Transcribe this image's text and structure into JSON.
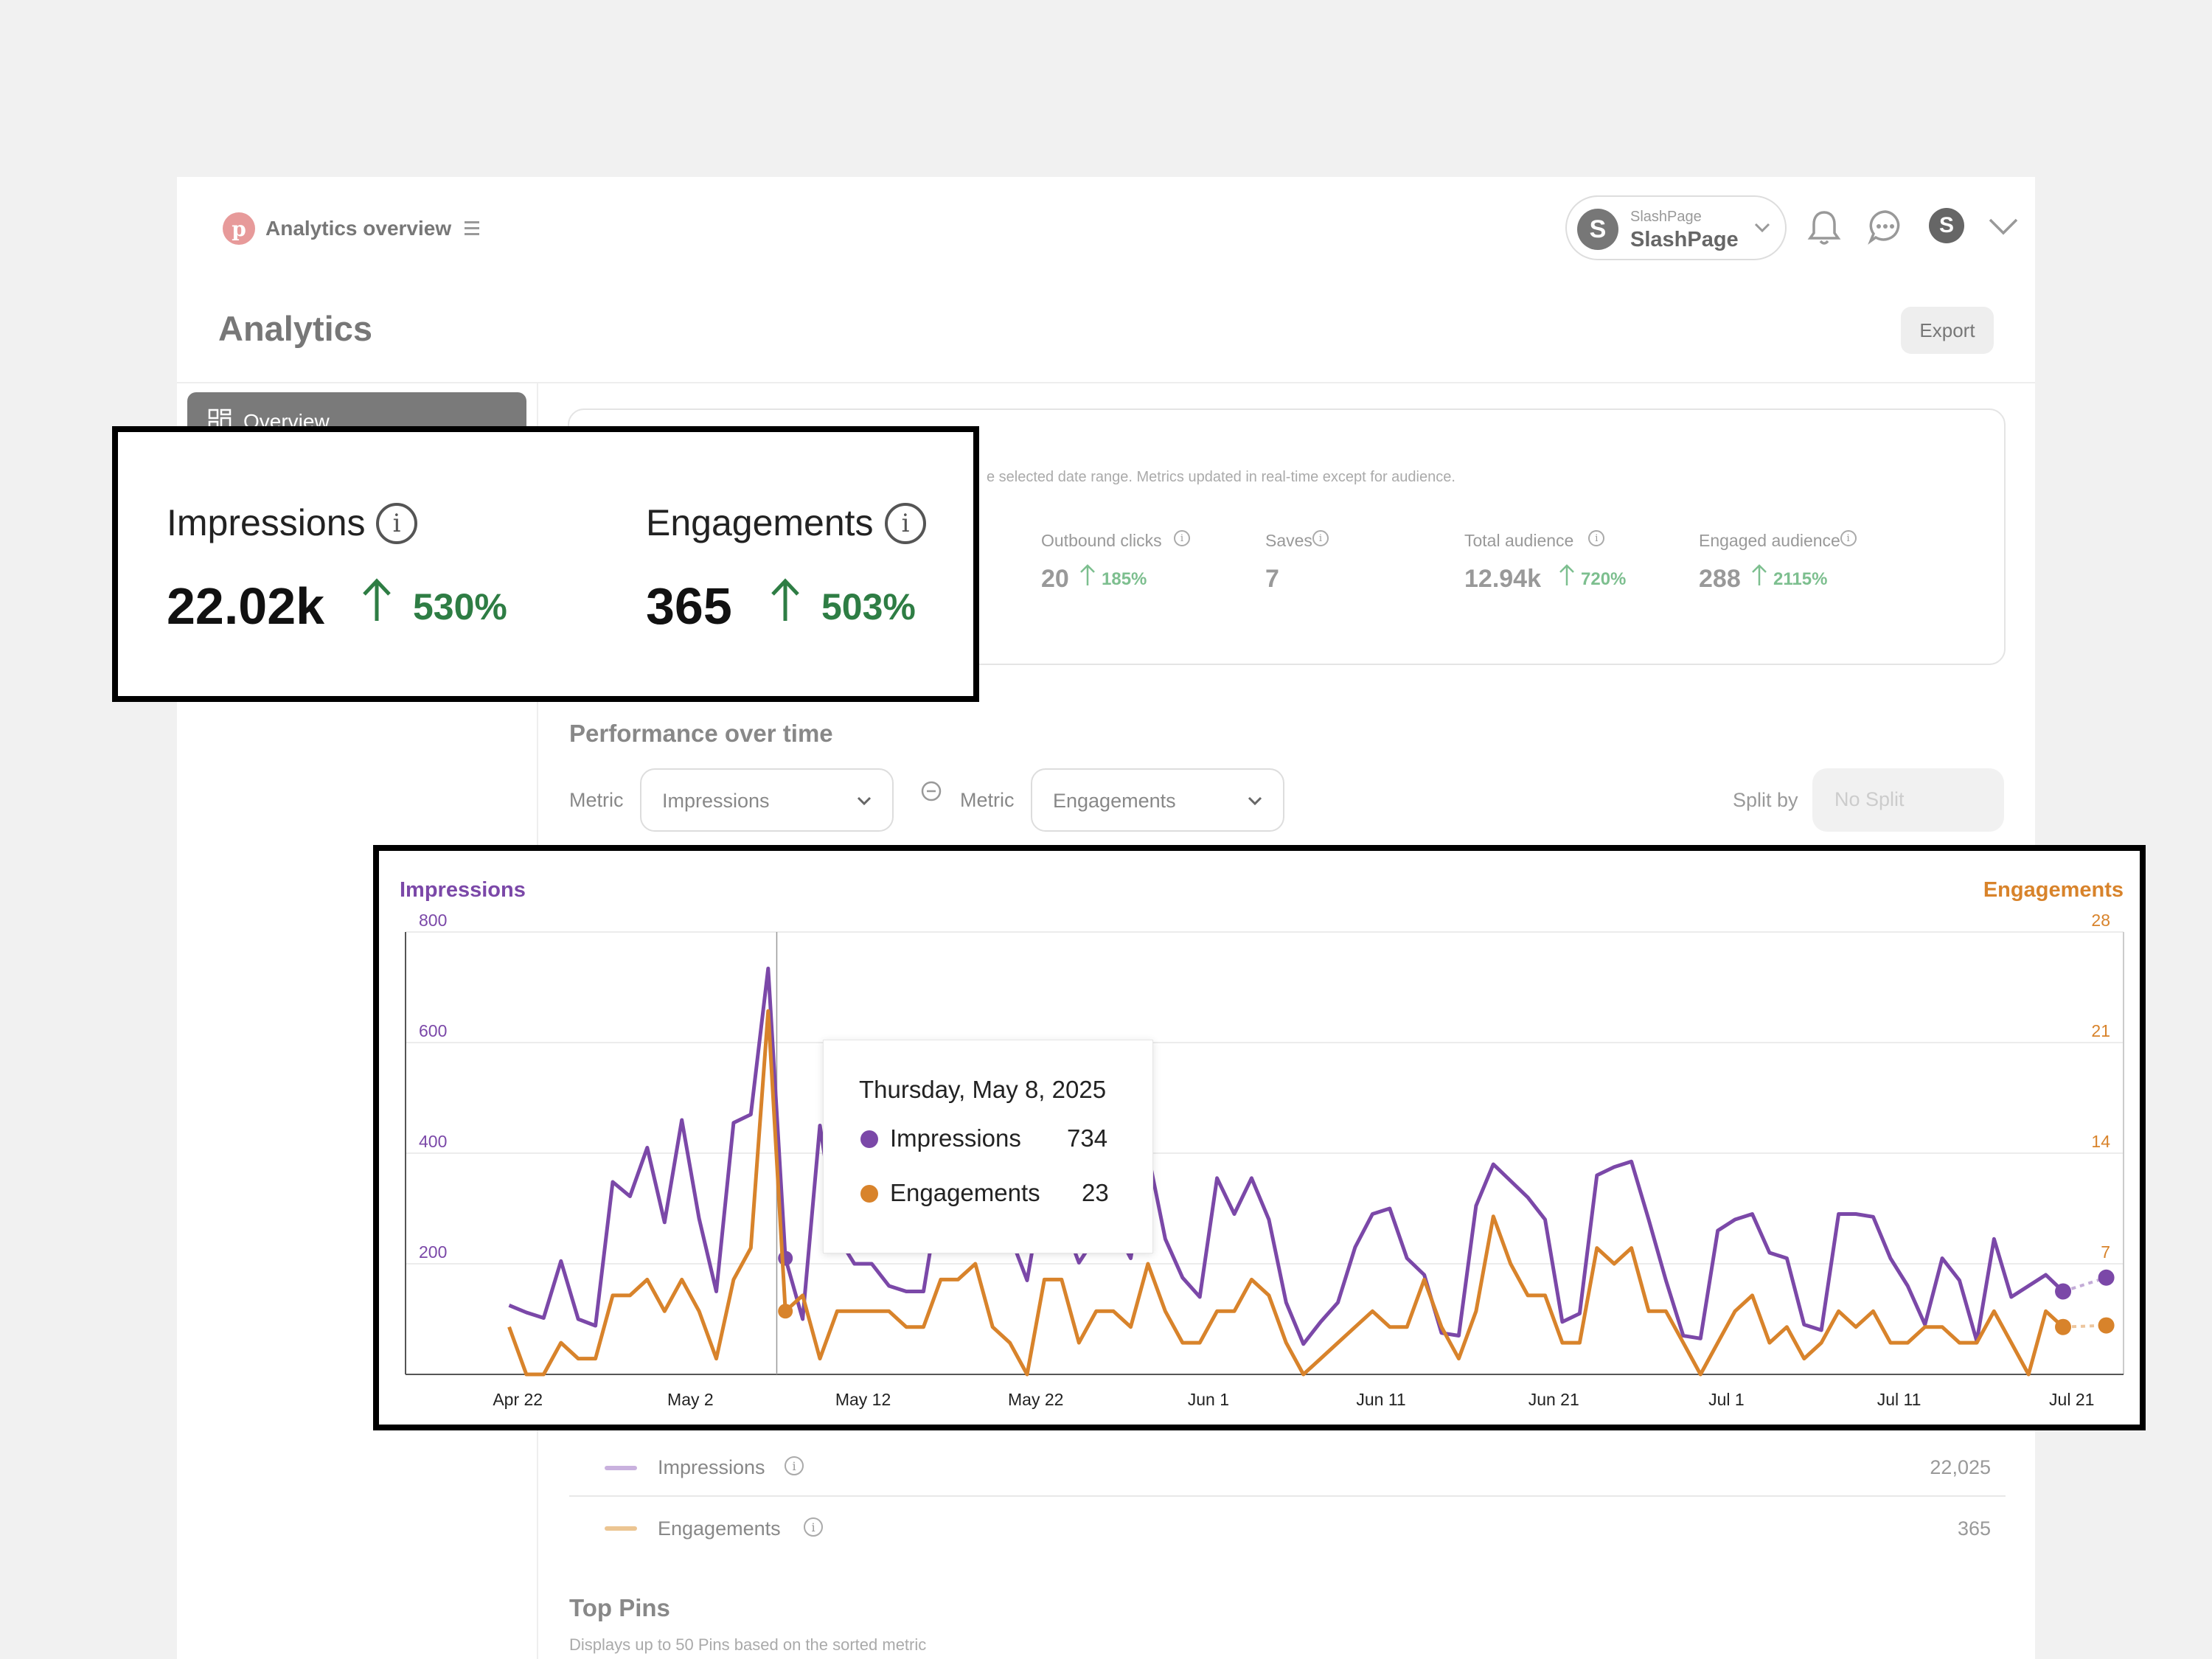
{
  "header": {
    "app_title": "Analytics overview",
    "account_caption": "SlashPage",
    "account_name": "SlashPage"
  },
  "page": {
    "title": "Analytics",
    "export_label": "Export"
  },
  "sidebar": {
    "items": [
      {
        "label": "Overview"
      }
    ]
  },
  "summary": {
    "note": "e selected date range. Metrics updated in real-time except for audience.",
    "metrics": [
      {
        "label": "Outbound clicks",
        "value": "20",
        "change": "185%"
      },
      {
        "label": "Saves",
        "value": "7",
        "change": ""
      },
      {
        "label": "Total audience",
        "value": "12.94k",
        "change": "720%"
      },
      {
        "label": "Engaged audience",
        "value": "288",
        "change": "2115%"
      }
    ]
  },
  "highlight": {
    "impressions": {
      "label": "Impressions",
      "value": "22.02k",
      "change": "530%"
    },
    "engagements": {
      "label": "Engagements",
      "value": "365",
      "change": "503%"
    }
  },
  "performance": {
    "title": "Performance over time",
    "metric_label_1": "Metric",
    "metric_value_1": "Impressions",
    "metric_label_2": "Metric",
    "metric_value_2": "Engagements",
    "split_label": "Split by",
    "split_placeholder": "No Split"
  },
  "tooltip": {
    "date": "Thursday, May 8, 2025",
    "rows": [
      {
        "label": "Impressions",
        "value": "734"
      },
      {
        "label": "Engagements",
        "value": "23"
      }
    ]
  },
  "legend_table": {
    "rows": [
      {
        "label": "Impressions",
        "total": "22,025"
      },
      {
        "label": "Engagements",
        "total": "365"
      }
    ]
  },
  "top_pins": {
    "title": "Top Pins",
    "subtitle": "Displays up to 50 Pins based on the sorted metric"
  },
  "colors": {
    "impressions": "#7b48a8",
    "engagements": "#d8832b",
    "positive": "#2e7d44",
    "positive_muted": "#7dbf8f"
  },
  "icons": [
    "pinterest-logo-icon",
    "menu-icon",
    "slashpage-logo-icon",
    "chevron-down-icon",
    "bell-icon",
    "chat-icon",
    "overview-grid-icon",
    "info-icon",
    "arrow-up-icon",
    "minus-circle-icon"
  ],
  "chart_data": {
    "type": "line",
    "left_axis_title": "Impressions",
    "right_axis_title": "Engagements",
    "x_tick_labels": [
      "Apr 22",
      "May 2",
      "May 12",
      "May 22",
      "Jun 1",
      "Jun 11",
      "Jun 21",
      "Jul 1",
      "Jul 11",
      "Jul 21"
    ],
    "x_tick_days": [
      0,
      10,
      20,
      30,
      40,
      50,
      60,
      70,
      80,
      90
    ],
    "x_range_days": [
      -6.5,
      93
    ],
    "ylim_left": [
      0,
      800
    ],
    "yticks_left": [
      200,
      400,
      600,
      800
    ],
    "ylim_right": [
      0,
      28
    ],
    "yticks_right": [
      7,
      14,
      21,
      28
    ],
    "grid": true,
    "series": [
      {
        "name": "Impressions",
        "axis": "left",
        "values": [
          125,
          112,
          102,
          205,
          100,
          88,
          348,
          322,
          410,
          275,
          460,
          282,
          150,
          455,
          470,
          734,
          210,
          100,
          450,
          250,
          200,
          200,
          160,
          150,
          150,
          340,
          270,
          370,
          330,
          252,
          170,
          350,
          285,
          202,
          250,
          270,
          210,
          400,
          245,
          175,
          140,
          355,
          290,
          355,
          280,
          130,
          55,
          95,
          130,
          230,
          290,
          300,
          210,
          180,
          75,
          70,
          305,
          380,
          350,
          320,
          280,
          95,
          110,
          360,
          375,
          385,
          280,
          170,
          70,
          65,
          260,
          280,
          290,
          220,
          210,
          90,
          80,
          290,
          290,
          285,
          210,
          160,
          90,
          210,
          170,
          60,
          245,
          140,
          160,
          180,
          150
        ]
      },
      {
        "name": "Engagements",
        "axis": "right",
        "values": [
          3,
          0,
          0,
          2,
          1,
          1,
          5,
          5,
          6,
          4,
          6,
          4,
          1,
          6,
          8,
          23,
          4,
          5,
          1,
          4,
          4,
          4,
          4,
          3,
          3,
          6,
          6,
          7,
          3,
          2,
          0,
          6,
          6,
          2,
          4,
          4,
          3,
          7,
          4,
          2,
          2,
          4,
          4,
          6,
          5,
          2,
          0,
          1,
          2,
          3,
          4,
          3,
          3,
          6,
          3,
          1,
          4,
          10,
          7,
          5,
          5,
          2,
          2,
          8,
          7,
          8,
          4,
          4,
          2,
          0,
          2,
          4,
          5,
          2,
          3,
          1,
          2,
          4,
          3,
          4,
          2,
          2,
          3,
          3,
          2,
          2,
          4,
          2,
          0,
          4,
          3
        ]
      }
    ],
    "series_start_day": -0.5,
    "series_step_days": 1,
    "tail_points": [
      {
        "series": "Impressions",
        "day": 92,
        "value": 175
      },
      {
        "series": "Engagements",
        "day": 92,
        "value": 3.1
      }
    ],
    "hover_day": 15
  }
}
